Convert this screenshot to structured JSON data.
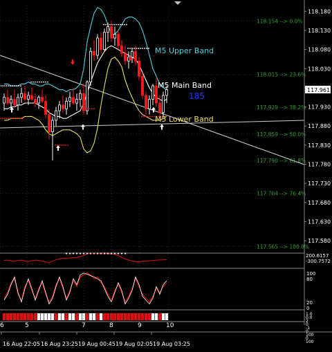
{
  "colors": {
    "background": "#000000",
    "grid": "#8a8a8a",
    "axis_text": "#ffffff",
    "bull_candle": "#ffffff",
    "bear_candle": "#ff1a1a",
    "upper_band": "#4fd0e0",
    "main_band": "#ffffff",
    "lower_band": "#f0e060",
    "fib": "#2e9e2e",
    "trend_line": "#d0d0d0",
    "count_text": "#1a3cff",
    "osc_red": "#e01010",
    "osc_white": "#ffffff",
    "price_box": "#ffffff"
  },
  "chart_data": {
    "type": "candlestick",
    "price_axis": {
      "ticks": [
        "118.180",
        "118.130",
        "118.080",
        "118.030",
        "117.980",
        "117.930",
        "117.880",
        "117.830",
        "117.780",
        "117.730",
        "117.680",
        "117.630",
        "117.580"
      ],
      "ylim": [
        117.555,
        118.195
      ],
      "current_price": "117.961",
      "current_value": 117.961
    },
    "time_axis": {
      "labels": [
        "16 Aug 22:05",
        "16 Aug 23:25",
        "19 Aug 00:45",
        "19 Aug 02:05",
        "19 Aug 03:25"
      ],
      "session_markers": [
        "5",
        "7",
        "8",
        "9",
        "10"
      ],
      "partial_marker": "6"
    },
    "candles": [
      {
        "o": 117.94,
        "h": 117.965,
        "l": 117.92,
        "c": 117.955
      },
      {
        "o": 117.955,
        "h": 117.975,
        "l": 117.935,
        "c": 117.94
      },
      {
        "o": 117.94,
        "h": 117.96,
        "l": 117.925,
        "c": 117.95
      },
      {
        "o": 117.95,
        "h": 117.975,
        "l": 117.93,
        "c": 117.935
      },
      {
        "o": 117.935,
        "h": 117.965,
        "l": 117.92,
        "c": 117.955
      },
      {
        "o": 117.955,
        "h": 117.98,
        "l": 117.94,
        "c": 117.965
      },
      {
        "o": 117.965,
        "h": 117.985,
        "l": 117.945,
        "c": 117.95
      },
      {
        "o": 117.95,
        "h": 117.97,
        "l": 117.935,
        "c": 117.96
      },
      {
        "o": 117.96,
        "h": 117.98,
        "l": 117.945,
        "c": 117.95
      },
      {
        "o": 117.95,
        "h": 117.965,
        "l": 117.93,
        "c": 117.94
      },
      {
        "o": 117.94,
        "h": 117.96,
        "l": 117.925,
        "c": 117.955
      },
      {
        "o": 117.955,
        "h": 117.975,
        "l": 117.94,
        "c": 117.945
      },
      {
        "o": 117.945,
        "h": 117.96,
        "l": 117.9,
        "c": 117.91
      },
      {
        "o": 117.91,
        "h": 117.925,
        "l": 117.845,
        "c": 117.865
      },
      {
        "o": 117.865,
        "h": 117.905,
        "l": 117.79,
        "c": 117.895
      },
      {
        "o": 117.895,
        "h": 117.93,
        "l": 117.88,
        "c": 117.92
      },
      {
        "o": 117.92,
        "h": 117.945,
        "l": 117.9,
        "c": 117.935
      },
      {
        "o": 117.935,
        "h": 117.96,
        "l": 117.915,
        "c": 117.925
      },
      {
        "o": 117.925,
        "h": 117.955,
        "l": 117.91,
        "c": 117.945
      },
      {
        "o": 117.945,
        "h": 117.97,
        "l": 117.93,
        "c": 117.955
      },
      {
        "o": 117.955,
        "h": 117.98,
        "l": 117.935,
        "c": 117.94
      },
      {
        "o": 117.94,
        "h": 117.965,
        "l": 117.92,
        "c": 117.95
      },
      {
        "o": 117.95,
        "h": 117.975,
        "l": 117.93,
        "c": 117.965
      },
      {
        "o": 117.965,
        "h": 117.99,
        "l": 117.91,
        "c": 117.92
      },
      {
        "o": 117.92,
        "h": 118.0,
        "l": 117.91,
        "c": 117.995
      },
      {
        "o": 117.995,
        "h": 118.085,
        "l": 117.985,
        "c": 118.075
      },
      {
        "o": 118.075,
        "h": 118.105,
        "l": 118.05,
        "c": 118.065
      },
      {
        "o": 118.065,
        "h": 118.12,
        "l": 118.055,
        "c": 118.11
      },
      {
        "o": 118.11,
        "h": 118.125,
        "l": 118.07,
        "c": 118.08
      },
      {
        "o": 118.08,
        "h": 118.135,
        "l": 118.075,
        "c": 118.125
      },
      {
        "o": 118.125,
        "h": 118.15,
        "l": 118.1,
        "c": 118.14
      },
      {
        "o": 118.14,
        "h": 118.155,
        "l": 118.1,
        "c": 118.11
      },
      {
        "o": 118.11,
        "h": 118.14,
        "l": 118.09,
        "c": 118.12
      },
      {
        "o": 118.12,
        "h": 118.13,
        "l": 118.08,
        "c": 118.09
      },
      {
        "o": 118.09,
        "h": 118.105,
        "l": 118.06,
        "c": 118.07
      },
      {
        "o": 118.07,
        "h": 118.09,
        "l": 118.04,
        "c": 118.05
      },
      {
        "o": 118.05,
        "h": 118.075,
        "l": 118.03,
        "c": 118.06
      },
      {
        "o": 118.06,
        "h": 118.085,
        "l": 118.045,
        "c": 118.075
      },
      {
        "o": 118.075,
        "h": 118.09,
        "l": 118.04,
        "c": 118.05
      },
      {
        "o": 118.05,
        "h": 118.06,
        "l": 118.0,
        "c": 118.01
      },
      {
        "o": 118.01,
        "h": 118.02,
        "l": 117.95,
        "c": 117.96
      },
      {
        "o": 117.96,
        "h": 117.97,
        "l": 117.91,
        "c": 117.925
      },
      {
        "o": 117.925,
        "h": 117.96,
        "l": 117.91,
        "c": 117.95
      },
      {
        "o": 117.95,
        "h": 117.99,
        "l": 117.935,
        "c": 117.985
      },
      {
        "o": 117.985,
        "h": 118.005,
        "l": 117.93,
        "c": 117.94
      },
      {
        "o": 117.94,
        "h": 117.96,
        "l": 117.9,
        "c": 117.915
      },
      {
        "o": 117.915,
        "h": 117.97,
        "l": 117.905,
        "c": 117.96
      },
      {
        "o": 117.96,
        "h": 117.985,
        "l": 117.94,
        "c": 117.975
      }
    ],
    "upper_band": [
      117.99,
      117.99,
      117.985,
      117.985,
      117.985,
      117.99,
      117.99,
      117.995,
      117.99,
      117.99,
      117.985,
      117.985,
      117.99,
      117.99,
      117.985,
      117.98,
      117.975,
      117.975,
      117.97,
      117.975,
      117.975,
      117.98,
      117.99,
      118.03,
      118.1,
      118.14,
      118.175,
      118.19,
      118.185,
      118.17,
      118.145,
      118.12,
      118.12,
      118.13,
      118.145,
      118.16,
      118.165,
      118.165,
      118.16,
      118.15,
      118.13,
      118.1,
      118.065,
      118.03,
      118.01,
      117.99,
      117.98,
      117.975
    ],
    "main_band": [
      117.925,
      117.925,
      117.93,
      117.93,
      117.935,
      117.935,
      117.94,
      117.94,
      117.94,
      117.94,
      117.935,
      117.93,
      117.925,
      117.915,
      117.91,
      117.905,
      117.905,
      117.9,
      117.9,
      117.905,
      117.91,
      117.915,
      117.92,
      117.94,
      117.965,
      117.995,
      118.02,
      118.045,
      118.06,
      118.075,
      118.085,
      118.09,
      118.085,
      118.08,
      118.075,
      118.07,
      118.065,
      118.06,
      118.055,
      118.04,
      118.02,
      118.0,
      117.98,
      117.965,
      117.955,
      117.95,
      117.945,
      117.95
    ],
    "lower_band": [
      117.895,
      117.895,
      117.9,
      117.9,
      117.9,
      117.9,
      117.905,
      117.905,
      117.905,
      117.9,
      117.895,
      117.885,
      117.87,
      117.86,
      117.855,
      117.86,
      117.865,
      117.87,
      117.87,
      117.87,
      117.865,
      117.86,
      117.85,
      117.82,
      117.81,
      117.815,
      117.835,
      117.875,
      117.935,
      117.985,
      118.03,
      118.055,
      118.06,
      118.05,
      118.035,
      118.0,
      117.975,
      117.955,
      117.935,
      117.92,
      117.91,
      117.905,
      117.9,
      117.895,
      117.895,
      117.895,
      117.9,
      117.905
    ],
    "band_labels": {
      "upper": "M5 Upper Band",
      "main": "M5 Main Band",
      "lower": "M5 Lower Band"
    },
    "counter": "185",
    "fib_levels": [
      {
        "label": "118.154 --> 0.0%",
        "price": 118.154
      },
      {
        "label": "118.015 --> 23.6%",
        "price": 118.015
      },
      {
        "label": "117.929 --> 38.2%",
        "price": 117.929
      },
      {
        "label": "117.859 --> 50.0%",
        "price": 117.859
      },
      {
        "label": "117.790 --> 61.8%",
        "price": 117.79
      },
      {
        "label": "117.704 --> 76.4%",
        "price": 117.704
      },
      {
        "label": "117.565 --> 100.0%",
        "price": 117.565
      }
    ],
    "cci": {
      "labels": [
        "200.6157",
        "-300.7572"
      ],
      "ylim": [
        -300.7572,
        200.6157
      ],
      "values": [
        -40,
        -30,
        -50,
        -70,
        -40,
        -30,
        -60,
        -80,
        -50,
        -30,
        -40,
        -60,
        -90,
        -120,
        -60,
        -20,
        10,
        30,
        20,
        40,
        50,
        60,
        80,
        120,
        180,
        190,
        195,
        190,
        185,
        180,
        175,
        170,
        160,
        120,
        60,
        10,
        -30,
        -60,
        -80,
        -90,
        -70,
        -60,
        -50,
        -40,
        -30,
        -25,
        -20,
        -10
      ]
    },
    "stochastic": {
      "labels": [
        "100",
        "80",
        "20",
        "0"
      ],
      "ylim": [
        0,
        100
      ],
      "red": [
        30,
        45,
        70,
        80,
        40,
        25,
        60,
        75,
        50,
        30,
        55,
        70,
        40,
        20,
        35,
        65,
        80,
        55,
        30,
        50,
        75,
        60,
        85,
        90,
        95,
        90,
        80,
        85,
        70,
        60,
        40,
        25,
        50,
        65,
        45,
        20,
        35,
        55,
        80,
        60,
        40,
        30,
        20,
        35,
        55,
        45,
        60,
        70
      ],
      "white": [
        25,
        40,
        65,
        85,
        45,
        20,
        55,
        80,
        55,
        25,
        50,
        75,
        45,
        15,
        30,
        60,
        85,
        60,
        25,
        45,
        80,
        65,
        90,
        95,
        92,
        88,
        85,
        80,
        75,
        55,
        35,
        20,
        45,
        70,
        50,
        15,
        30,
        50,
        85,
        65,
        35,
        25,
        15,
        30,
        60,
        40,
        65,
        75
      ]
    },
    "histogram_markers": [
      "5",
      "7",
      "8",
      "9",
      "10"
    ],
    "bottom_panel_labels": [
      "1.0",
      "0.0",
      "2",
      "0",
      "-1",
      "0",
      "100",
      "0",
      "100"
    ]
  }
}
